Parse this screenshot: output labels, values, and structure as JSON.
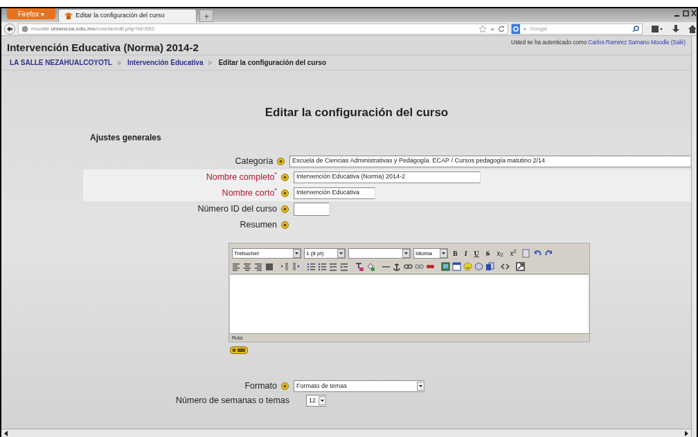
{
  "browser": {
    "menu_button": "Firefox ▾",
    "tabs": [
      {
        "title": "Editar la configuración del curso",
        "selected": true
      }
    ],
    "new_tab": "+",
    "url": "moodle.**ulsaneza.edu.mx**/course/edit.php?id=652",
    "search_placeholder": "Google"
  },
  "page": {
    "course_title": "Intervención Educativa (Norma) 2014-2",
    "login": {
      "prefix": "Usted se ha autenticado como",
      "user": "Carlos Ramirez Samano Moodle",
      "logout": "(Salir)"
    },
    "breadcrumb": [
      {
        "label": "LA SALLE NEZAHUALCOYOTL",
        "link": true
      },
      {
        "label": "Intervención Educativa",
        "link": true
      },
      {
        "label": "Editar la configuración del curso",
        "link": false
      }
    ],
    "heading": "Editar la configuración del curso",
    "section": "Ajustes generales",
    "fields": [
      {
        "label": "Categoría",
        "required": false,
        "help": true,
        "kind": "wide",
        "value": "Escuela de Ciencias Administrativas y Pedagogía. ECAP / Cursos pedagogía matutino 2/14"
      },
      {
        "label": "Nombre completo$^{*}$",
        "required": true,
        "help": true,
        "kind": "text",
        "value": "Intervención Educativa (Norma) 2014-2"
      },
      {
        "label": "Nombre corto$^{*}$",
        "required": true,
        "help": true,
        "kind": "short",
        "value": "Intervención Educativa"
      },
      {
        "label": "Número ID del curso",
        "required": false,
        "help": true,
        "kind": "id"
      },
      {
        "label": "Resumen",
        "required": false,
        "help": true,
        "kind": "editor"
      }
    ],
    "editor": {
      "selects": [
        {
          "value": "Trebuchet",
          "kind": "font"
        },
        {
          "value": "1 (8 pt)",
          "kind": "size"
        },
        {
          "kind": "blank"
        },
        {
          "value": "Idioma",
          "kind": "lang"
        }
      ],
      "format_buttons": [
        {
          "label": "B",
          "kind": "bold"
        },
        {
          "label": "I",
          "kind": "italic"
        },
        {
          "label": "U",
          "kind": "underline"
        },
        {
          "label": "S",
          "kind": "strike"
        },
        {
          "label": "x$_{2}$",
          "kind": "sub"
        },
        {
          "label": "x$^{2}$",
          "kind": "sup"
        }
      ],
      "path_label": "Ruta:"
    },
    "fields_after": [
      {
        "label": "Formato",
        "help": true,
        "kind": "select",
        "value": "Formato de temas"
      },
      {
        "label": "Número de semanas o temas",
        "help": false,
        "kind": "small-select",
        "value": "12"
      }
    ]
  }
}
